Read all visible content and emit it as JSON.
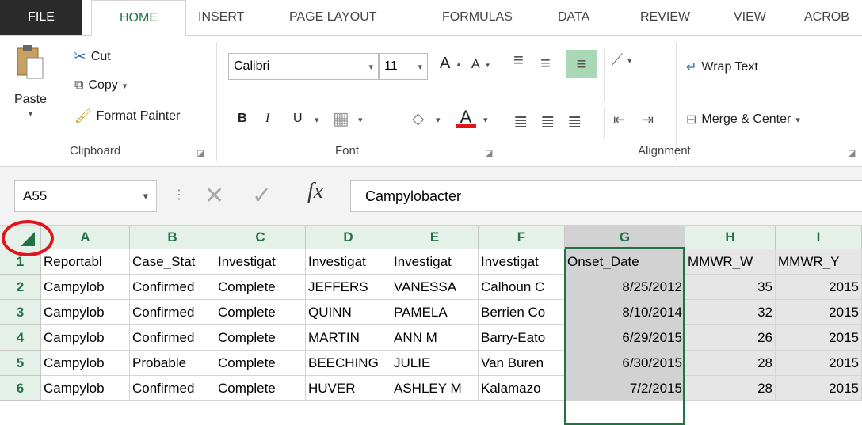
{
  "tabs": [
    "FILE",
    "HOME",
    "INSERT",
    "PAGE LAYOUT",
    "FORMULAS",
    "DATA",
    "REVIEW",
    "VIEW",
    "ACROB"
  ],
  "clipboard": {
    "paste": "Paste",
    "cut": "Cut",
    "copy": "Copy",
    "format_painter": "Format Painter",
    "label": "Clipboard"
  },
  "font": {
    "name": "Calibri",
    "size": "11",
    "bold": "B",
    "italic": "I",
    "underline": "U",
    "font_color": "A",
    "grow": "A",
    "shrink": "A",
    "label": "Font"
  },
  "alignment": {
    "wrap_text": "Wrap Text",
    "merge_center": "Merge & Center",
    "label": "Alignment"
  },
  "formula_bar": {
    "name_box": "A55",
    "fx": "fx",
    "value": "Campylobacter"
  },
  "colors": {
    "accent": "#217346",
    "file_tab": "#2b2b2b",
    "annotation": "#e3131b",
    "font_color_bar": "#e3131b"
  },
  "columns": [
    "A",
    "B",
    "C",
    "D",
    "E",
    "F",
    "G",
    "H",
    "I"
  ],
  "rows": [
    {
      "n": "1",
      "cells": [
        "Reportabl",
        "Case_Stat",
        "Investigat",
        "Investigat",
        "Investigat",
        "Investigat",
        "Onset_Date",
        "MMWR_W",
        "MMWR_Y"
      ]
    },
    {
      "n": "2",
      "cells": [
        "Campylob",
        "Confirmed",
        "Complete",
        "JEFFERS",
        "VANESSA",
        "Calhoun C",
        "8/25/2012",
        "35",
        "2015"
      ]
    },
    {
      "n": "3",
      "cells": [
        "Campylob",
        "Confirmed",
        "Complete",
        "QUINN",
        "PAMELA",
        "Berrien Co",
        "8/10/2014",
        "32",
        "2015"
      ]
    },
    {
      "n": "4",
      "cells": [
        "Campylob",
        "Confirmed",
        "Complete",
        "MARTIN",
        "ANN M",
        "Barry-Eato",
        "6/29/2015",
        "26",
        "2015"
      ]
    },
    {
      "n": "5",
      "cells": [
        "Campylob",
        "Probable",
        "Complete",
        "BEECHING",
        "JULIE",
        "Van Buren",
        "6/30/2015",
        "28",
        "2015"
      ]
    },
    {
      "n": "6",
      "cells": [
        "Campylob",
        "Confirmed",
        "Complete",
        "HUVER",
        "ASHLEY M",
        "Kalamazo",
        "7/2/2015",
        "28",
        "2015"
      ]
    }
  ]
}
